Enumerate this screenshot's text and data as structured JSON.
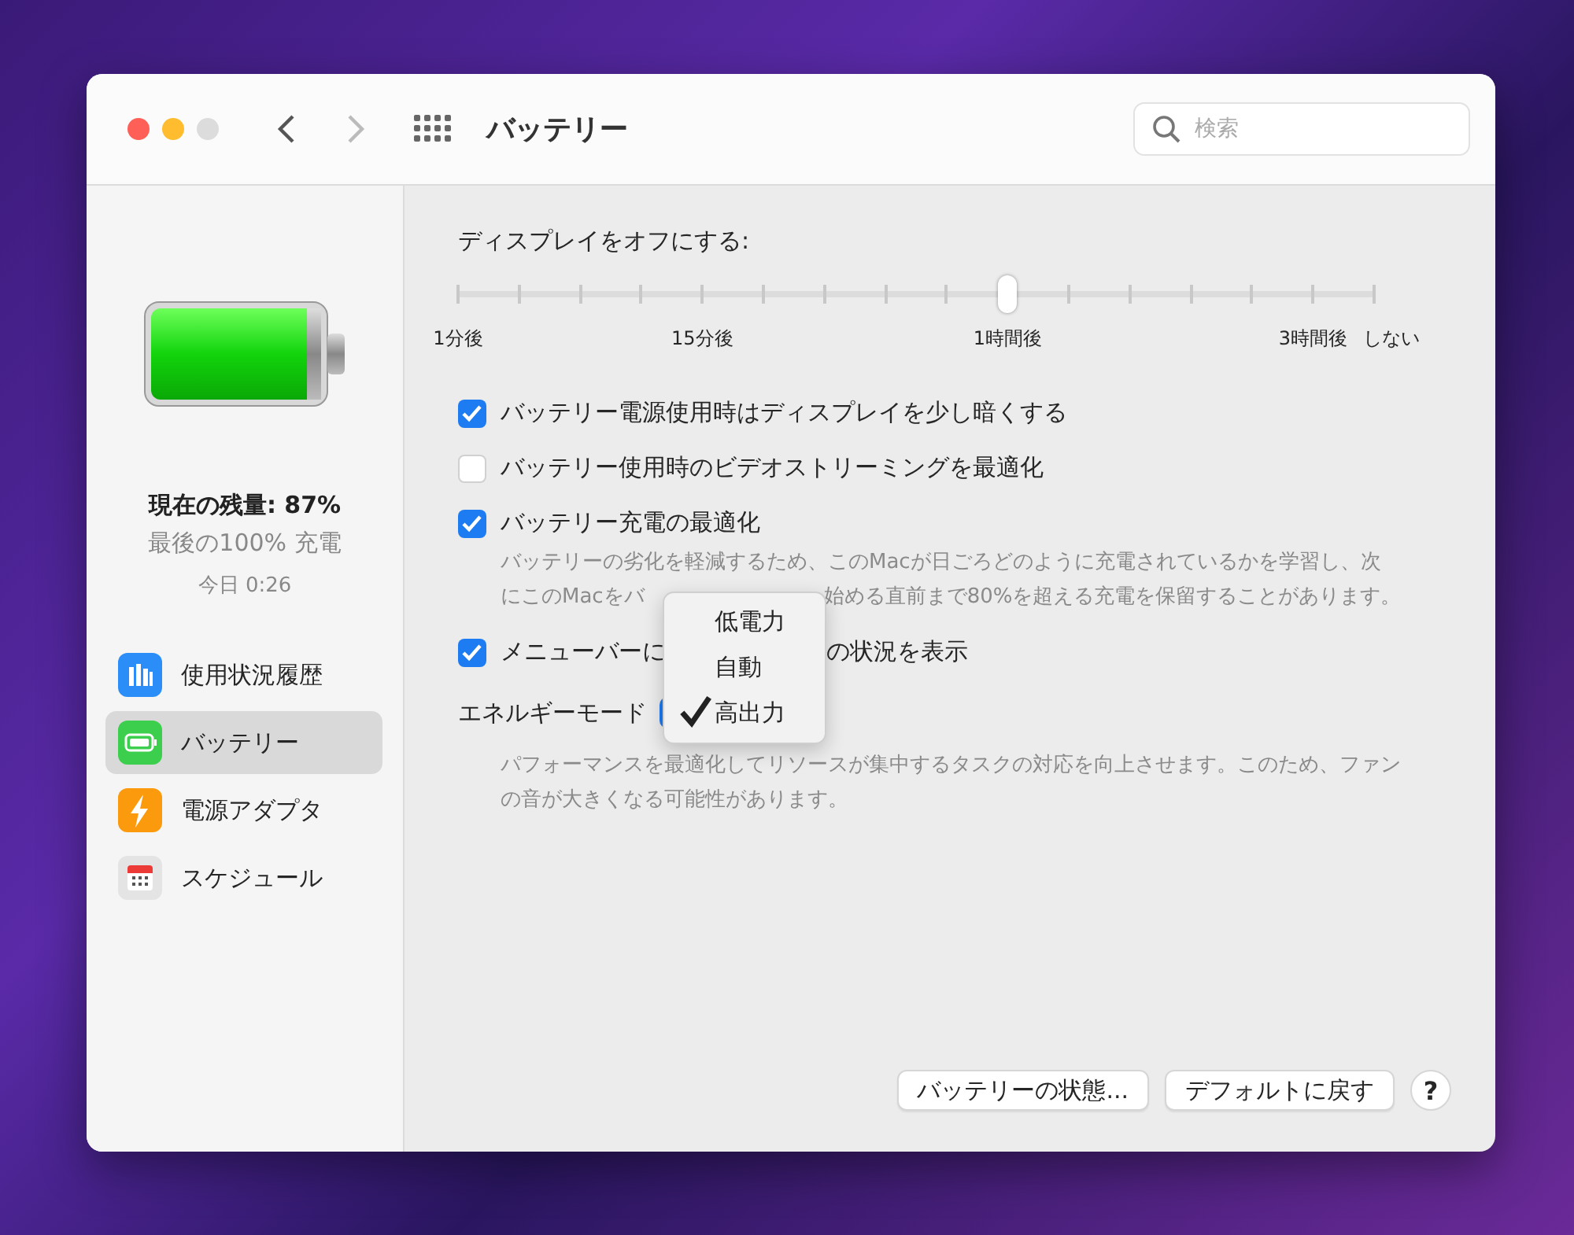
{
  "window": {
    "title": "バッテリー",
    "search": {
      "placeholder": "検索"
    },
    "back_enabled": true,
    "forward_enabled": false
  },
  "sidebar": {
    "status": {
      "level_text": "現在の残量: 87%",
      "last_charge": "最後の100% 充電",
      "time": "今日 0:26"
    },
    "items": [
      {
        "label": "使用状況履歴",
        "kind": "chart",
        "selected": false
      },
      {
        "label": "バッテリー",
        "kind": "battery",
        "selected": true
      },
      {
        "label": "電源アダプタ",
        "kind": "bolt",
        "selected": false
      },
      {
        "label": "スケジュール",
        "kind": "calendar",
        "selected": false
      }
    ]
  },
  "display_off": {
    "label": "ディスプレイをオフにする:",
    "level": 0.6,
    "tick_labels": [
      "1分後",
      "15分後",
      "1時間後",
      "3時間後",
      "しない"
    ]
  },
  "options": [
    {
      "kind": "checkbox",
      "checked": true,
      "parts": [
        "バッテリー電源使用時はディスプレイを少し暗くする"
      ]
    },
    {
      "kind": "checkbox",
      "checked": false,
      "parts": [
        "バッテリー使用時のビデオストリーミングを最適化"
      ]
    },
    {
      "kind": "checkbox",
      "checked": true,
      "parts": [
        "バッテリー充電の最適化"
      ]
    },
    {
      "kind": "description",
      "lines": [
        [
          "バッテリーの劣化を軽減するため、このMacが日ごろどのように充電されているかを学習し、次"
        ],
        [
          "にこのMacをバ",
          "始める直前まで80%を超える充電を保留することがあります。"
        ]
      ]
    },
    {
      "kind": "checkbox",
      "checked": true,
      "parts": [
        "メニューバーに",
        "の状況を表示"
      ]
    },
    {
      "kind": "popup",
      "parts": [
        "エネルギーモード"
      ]
    },
    {
      "kind": "description",
      "lines": [
        [
          "パフォーマンスを最適化してリソースが集中するタスクの対応を向上させます。このため、ファン"
        ],
        [
          "の音が大きくなる可能性があります。"
        ]
      ]
    }
  ],
  "energy_menu": [
    {
      "label": "低電力",
      "selected": false
    },
    {
      "label": "自動",
      "selected": false
    },
    {
      "label": "高出力",
      "selected": true
    }
  ],
  "buttons": [
    {
      "kind": "text",
      "label": "バッテリーの状態..."
    },
    {
      "kind": "text",
      "label": "デフォルトに戻す"
    },
    {
      "kind": "help",
      "label": "?"
    }
  ]
}
